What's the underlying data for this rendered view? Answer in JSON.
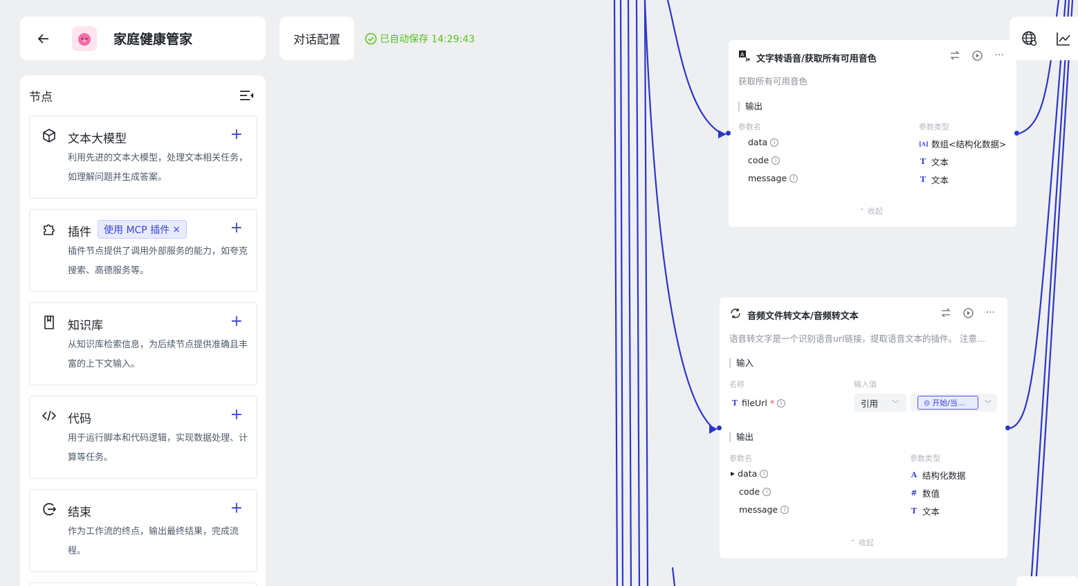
{
  "app": {
    "title": "家庭健康管家",
    "config_button": "对话配置",
    "autosave_text": "已自动保存 14:29:43"
  },
  "sidebar": {
    "title": "节点",
    "items": [
      {
        "title": "文本大模型",
        "desc": "利用先进的文本大模型，处理文本相关任务，如理解问题并生成答案。",
        "icon": "cube-icon"
      },
      {
        "title": "插件",
        "tag": "使用 MCP 插件",
        "desc": "插件节点提供了调用外部服务的能力，如夸克搜索、高德服务等。",
        "icon": "puzzle-icon"
      },
      {
        "title": "知识库",
        "desc": "从知识库检索信息，为后续节点提供准确且丰富的上下文输入。",
        "icon": "book-icon"
      },
      {
        "title": "代码",
        "desc": "用于运行脚本和代码逻辑，实现数据处理、计算等任务。",
        "icon": "code-icon"
      },
      {
        "title": "结束",
        "desc": "作为工作流的终点，输出最终结果，完成流程。",
        "icon": "exit-icon"
      }
    ]
  },
  "node_tts": {
    "title": "文字转语音/获取所有可用音色",
    "desc": "获取所有可用音色",
    "output_label": "输出",
    "col_name": "参数名",
    "col_type": "参数类型",
    "params": [
      {
        "name": "data",
        "type": "数组<结构化数据>",
        "type_icon": "[A]"
      },
      {
        "name": "code",
        "type": "文本",
        "type_icon": "T"
      },
      {
        "name": "message",
        "type": "文本",
        "type_icon": "T"
      }
    ],
    "collapse": "收起"
  },
  "node_asr": {
    "title": "音频文件转文本/音频转文本",
    "desc": "语音转文字是一个识别语音url链接，提取语音文本的插件。 注意...",
    "input_label": "输入",
    "col_in_name": "名称",
    "col_in_value": "输入值",
    "input_param": "fileUrl",
    "input_required": "*",
    "input_mode": "引用",
    "input_ref": "开始/当...",
    "output_label": "输出",
    "col_name": "参数名",
    "col_type": "参数类型",
    "params": [
      {
        "name": "data",
        "type": "结构化数据",
        "type_icon": "A"
      },
      {
        "name": "code",
        "type": "数值",
        "type_icon": "#"
      },
      {
        "name": "message",
        "type": "文本",
        "type_icon": "T"
      }
    ],
    "collapse": "收起"
  },
  "colors": {
    "accent": "#3a44d8",
    "edge": "#2a35c9",
    "success": "#52c41a"
  }
}
